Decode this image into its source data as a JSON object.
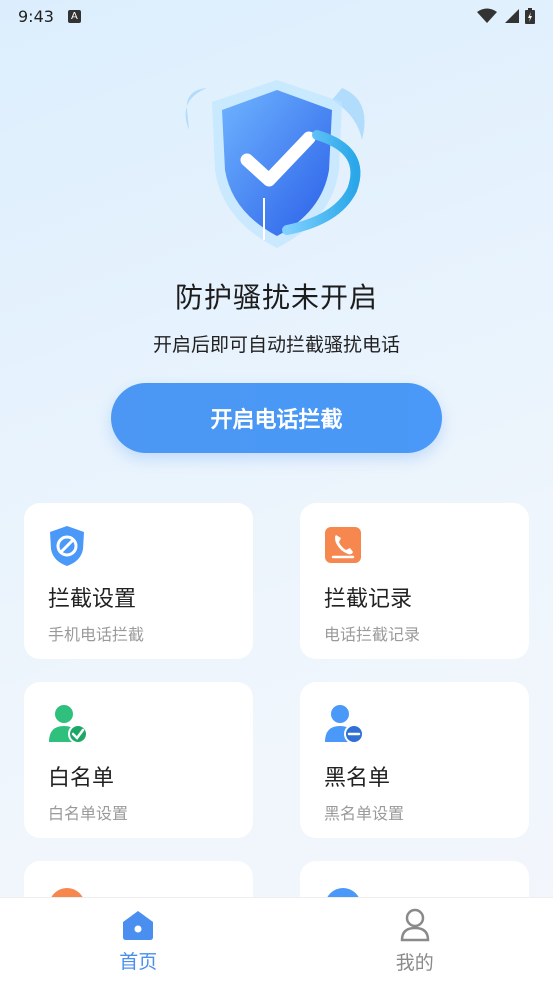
{
  "status": {
    "time": "9:43",
    "a_badge": "A"
  },
  "hero": {
    "icon": "shield-check-icon"
  },
  "title": "防护骚扰未开启",
  "subtitle": "开启后即可自动拦截骚扰电话",
  "cta_label": "开启电话拦截",
  "cards": [
    {
      "icon": "block-shield-icon",
      "title": "拦截设置",
      "subtitle": "手机电话拦截"
    },
    {
      "icon": "call-log-icon",
      "title": "拦截记录",
      "subtitle": "电话拦截记录"
    },
    {
      "icon": "user-check-icon",
      "title": "白名单",
      "subtitle": "白名单设置"
    },
    {
      "icon": "user-minus-icon",
      "title": "黑名单",
      "subtitle": "黑名单设置"
    }
  ],
  "nav": [
    {
      "label": "首页",
      "icon": "home-icon",
      "active": true
    },
    {
      "label": "我的",
      "icon": "profile-icon",
      "active": false
    }
  ],
  "colors": {
    "accent": "#4a98f7",
    "orange": "#f5874f",
    "green": "#22c07a"
  }
}
